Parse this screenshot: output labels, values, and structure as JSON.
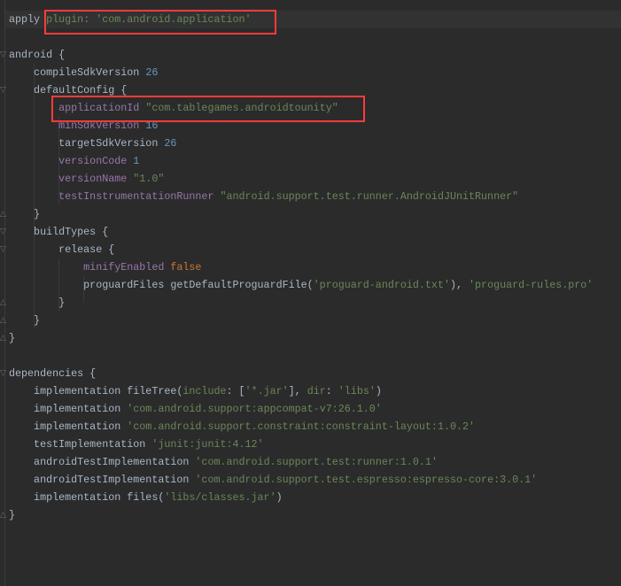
{
  "editor": {
    "colors": {
      "background": "#2b2b2b",
      "string": "#6a8759",
      "number": "#6897bb",
      "property": "#9876aa",
      "keyword": "#cc7832",
      "text": "#a9b7c6",
      "highlight_box": "#ff3b3b"
    },
    "lines": [
      [
        [
          "apply ",
          "plain"
        ],
        [
          "plugin",
          "str"
        ],
        [
          ": ",
          "dim"
        ],
        [
          "'com.android.application'",
          "str"
        ]
      ],
      [],
      [
        [
          "android {",
          "plain"
        ]
      ],
      [
        [
          "    compileSdkVersion ",
          "plain"
        ],
        [
          "26",
          "num"
        ]
      ],
      [
        [
          "    defaultConfig {",
          "plain"
        ]
      ],
      [
        [
          "        ",
          "plain"
        ],
        [
          "applicationId ",
          "prop"
        ],
        [
          "\"com.tablegames.androidtounity\"",
          "str"
        ]
      ],
      [
        [
          "        ",
          "plain"
        ],
        [
          "minSdkVersion ",
          "prop"
        ],
        [
          "16",
          "num"
        ]
      ],
      [
        [
          "        targetSdkVersion ",
          "plain"
        ],
        [
          "26",
          "num"
        ]
      ],
      [
        [
          "        ",
          "plain"
        ],
        [
          "versionCode ",
          "prop"
        ],
        [
          "1",
          "num"
        ]
      ],
      [
        [
          "        ",
          "plain"
        ],
        [
          "versionName ",
          "prop"
        ],
        [
          "\"1.0\"",
          "str"
        ]
      ],
      [
        [
          "        ",
          "plain"
        ],
        [
          "testInstrumentationRunner ",
          "prop"
        ],
        [
          "\"android.support.test.runner.AndroidJUnitRunner\"",
          "str"
        ]
      ],
      [
        [
          "    }",
          "plain"
        ]
      ],
      [
        [
          "    buildTypes {",
          "plain"
        ]
      ],
      [
        [
          "        release {",
          "plain"
        ]
      ],
      [
        [
          "            ",
          "plain"
        ],
        [
          "minifyEnabled ",
          "prop"
        ],
        [
          "false",
          "kw"
        ]
      ],
      [
        [
          "            proguardFiles getDefaultProguardFile(",
          "plain"
        ],
        [
          "'proguard-android.txt'",
          "str"
        ],
        [
          "), ",
          "plain"
        ],
        [
          "'proguard-rules.pro'",
          "str"
        ]
      ],
      [
        [
          "        }",
          "plain"
        ]
      ],
      [
        [
          "    }",
          "plain"
        ]
      ],
      [
        [
          "}",
          "plain"
        ]
      ],
      [],
      [
        [
          "dependencies {",
          "plain"
        ]
      ],
      [
        [
          "    implementation fileTree(",
          "plain"
        ],
        [
          "include",
          "str"
        ],
        [
          ": [",
          "plain"
        ],
        [
          "'*.jar'",
          "str"
        ],
        [
          "], ",
          "plain"
        ],
        [
          "dir",
          "str"
        ],
        [
          ": ",
          "plain"
        ],
        [
          "'libs'",
          "str"
        ],
        [
          ")",
          "plain"
        ]
      ],
      [
        [
          "    implementation ",
          "plain"
        ],
        [
          "'com.android.support:appcompat-v7:26.1.0'",
          "str"
        ]
      ],
      [
        [
          "    implementation ",
          "plain"
        ],
        [
          "'com.android.support.constraint:constraint-layout:1.0.2'",
          "str"
        ]
      ],
      [
        [
          "    testImplementation ",
          "plain"
        ],
        [
          "'junit:junit:4.12'",
          "str"
        ]
      ],
      [
        [
          "    androidTestImplementation ",
          "plain"
        ],
        [
          "'com.android.support.test:runner:1.0.1'",
          "str"
        ]
      ],
      [
        [
          "    androidTestImplementation ",
          "plain"
        ],
        [
          "'com.android.support.test.espresso:espresso-core:3.0.1'",
          "str"
        ]
      ],
      [
        [
          "    implementation files(",
          "plain"
        ],
        [
          "'libs/classes.jar'",
          "str"
        ],
        [
          ")",
          "plain"
        ]
      ],
      [
        [
          "}",
          "plain"
        ]
      ]
    ]
  }
}
